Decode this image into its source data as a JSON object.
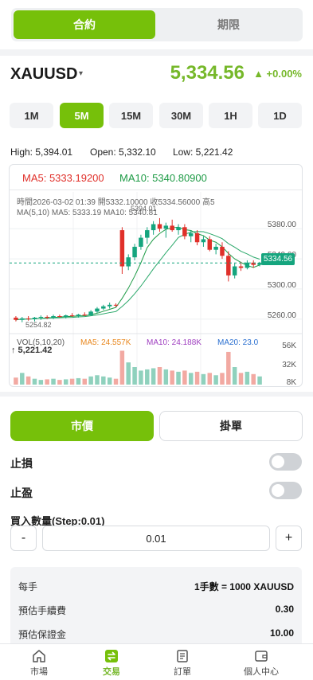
{
  "top_tabs": {
    "contract": "合約",
    "futures": "期限"
  },
  "symbol": {
    "name": "XAUUSD",
    "caret": "▾",
    "price": "5,334.56",
    "change": "▲ +0.00%"
  },
  "timeframes": [
    "1M",
    "5M",
    "15M",
    "30M",
    "1H",
    "1D"
  ],
  "active_timeframe": "5M",
  "stats": {
    "high": "High: 5,394.01",
    "open": "Open: 5,332.10",
    "low": "Low: 5,221.42"
  },
  "chart_header": {
    "ma5": "MA5: 5333.19200",
    "ma10": "MA10: 5340.80900"
  },
  "chart_info": {
    "line1": "時間2026-03-02 01:39   開5332.10000   收5334.56000   高5",
    "line2": "MA(5,10)     MA5: 5333.19     MA10: 5340.81"
  },
  "chart_data": {
    "type": "candlestick",
    "y_ticks": [
      "5380.00",
      "5340.00",
      "5300.00",
      "5260.00"
    ],
    "ylim": [
      5245,
      5395
    ],
    "last_price_tag": "5334.56",
    "last_price": 5334.56,
    "high_annotation": "5394.01",
    "low_annotation": "5254.82",
    "volume_ticks": [
      "56K",
      "32K",
      "8K"
    ],
    "volume_header": {
      "vol": "VOL(5,10,20)",
      "ma5": "MA5: 24.557K",
      "ma10": "MA10: 24.188K",
      "ma20": "MA20: 23.0"
    },
    "volume_big": "↑ 5,221.42",
    "candles": [
      {
        "o": 5262,
        "h": 5264,
        "l": 5257,
        "c": 5259,
        "v": 12
      },
      {
        "o": 5259,
        "h": 5263,
        "l": 5256,
        "c": 5261,
        "v": 20
      },
      {
        "o": 5261,
        "h": 5264,
        "l": 5258,
        "c": 5260,
        "v": 14
      },
      {
        "o": 5260,
        "h": 5263,
        "l": 5257,
        "c": 5262,
        "v": 10
      },
      {
        "o": 5262,
        "h": 5265,
        "l": 5259,
        "c": 5263,
        "v": 8
      },
      {
        "o": 5263,
        "h": 5265,
        "l": 5260,
        "c": 5262,
        "v": 9
      },
      {
        "o": 5262,
        "h": 5266,
        "l": 5260,
        "c": 5264,
        "v": 10
      },
      {
        "o": 5264,
        "h": 5266,
        "l": 5262,
        "c": 5263,
        "v": 8
      },
      {
        "o": 5263,
        "h": 5266,
        "l": 5261,
        "c": 5265,
        "v": 9
      },
      {
        "o": 5265,
        "h": 5268,
        "l": 5263,
        "c": 5264,
        "v": 10
      },
      {
        "o": 5264,
        "h": 5267,
        "l": 5262,
        "c": 5266,
        "v": 11
      },
      {
        "o": 5266,
        "h": 5269,
        "l": 5264,
        "c": 5265,
        "v": 10
      },
      {
        "o": 5265,
        "h": 5272,
        "l": 5264,
        "c": 5270,
        "v": 14
      },
      {
        "o": 5270,
        "h": 5276,
        "l": 5268,
        "c": 5274,
        "v": 16
      },
      {
        "o": 5274,
        "h": 5279,
        "l": 5272,
        "c": 5277,
        "v": 14
      },
      {
        "o": 5277,
        "h": 5282,
        "l": 5274,
        "c": 5279,
        "v": 12
      },
      {
        "o": 5279,
        "h": 5281,
        "l": 5276,
        "c": 5278,
        "v": 10
      },
      {
        "o": 5378,
        "h": 5382,
        "l": 5320,
        "c": 5330,
        "v": 58
      },
      {
        "o": 5330,
        "h": 5346,
        "l": 5325,
        "c": 5342,
        "v": 38
      },
      {
        "o": 5342,
        "h": 5360,
        "l": 5338,
        "c": 5356,
        "v": 30
      },
      {
        "o": 5356,
        "h": 5372,
        "l": 5352,
        "c": 5368,
        "v": 24
      },
      {
        "o": 5368,
        "h": 5382,
        "l": 5360,
        "c": 5378,
        "v": 26
      },
      {
        "o": 5378,
        "h": 5390,
        "l": 5372,
        "c": 5386,
        "v": 28
      },
      {
        "o": 5386,
        "h": 5394,
        "l": 5376,
        "c": 5380,
        "v": 30
      },
      {
        "o": 5380,
        "h": 5388,
        "l": 5368,
        "c": 5384,
        "v": 26
      },
      {
        "o": 5384,
        "h": 5392,
        "l": 5376,
        "c": 5378,
        "v": 24
      },
      {
        "o": 5378,
        "h": 5386,
        "l": 5372,
        "c": 5382,
        "v": 22
      },
      {
        "o": 5382,
        "h": 5386,
        "l": 5366,
        "c": 5370,
        "v": 24
      },
      {
        "o": 5370,
        "h": 5378,
        "l": 5362,
        "c": 5374,
        "v": 20
      },
      {
        "o": 5374,
        "h": 5378,
        "l": 5358,
        "c": 5362,
        "v": 22
      },
      {
        "o": 5362,
        "h": 5370,
        "l": 5356,
        "c": 5366,
        "v": 18
      },
      {
        "o": 5366,
        "h": 5370,
        "l": 5350,
        "c": 5352,
        "v": 20
      },
      {
        "o": 5352,
        "h": 5360,
        "l": 5346,
        "c": 5356,
        "v": 16
      },
      {
        "o": 5356,
        "h": 5362,
        "l": 5340,
        "c": 5344,
        "v": 20
      },
      {
        "o": 5344,
        "h": 5350,
        "l": 5310,
        "c": 5318,
        "v": 56
      },
      {
        "o": 5318,
        "h": 5334,
        "l": 5314,
        "c": 5330,
        "v": 30
      },
      {
        "o": 5330,
        "h": 5336,
        "l": 5324,
        "c": 5328,
        "v": 20
      },
      {
        "o": 5328,
        "h": 5338,
        "l": 5326,
        "c": 5335,
        "v": 22
      },
      {
        "o": 5335,
        "h": 5338,
        "l": 5328,
        "c": 5332,
        "v": 18
      },
      {
        "o": 5332,
        "h": 5336,
        "l": 5330,
        "c": 5334.56,
        "v": 14
      }
    ]
  },
  "order": {
    "market_tab": "市價",
    "limit_tab": "掛單",
    "stop_loss": "止損",
    "take_profit": "止盈",
    "qty_label": "買入數量(Step:0.01)",
    "minus": "-",
    "plus": "+",
    "qty_value": "0.01"
  },
  "summary": [
    {
      "key": "每手",
      "value": "1手數 = 1000 XAUUSD"
    },
    {
      "key": "預估手續費",
      "value": "0.30"
    },
    {
      "key": "預估保證金",
      "value": "10.00"
    }
  ],
  "tabbar": [
    {
      "label": "市場",
      "icon": "home-icon"
    },
    {
      "label": "交易",
      "icon": "swap-icon"
    },
    {
      "label": "訂單",
      "icon": "document-icon"
    },
    {
      "label": "個人中心",
      "icon": "wallet-icon"
    }
  ],
  "colors": {
    "accent": "#76c00a",
    "up": "#15a57e",
    "down": "#e0302a",
    "ma5": "#e0302a",
    "ma10": "#1e9b46"
  }
}
